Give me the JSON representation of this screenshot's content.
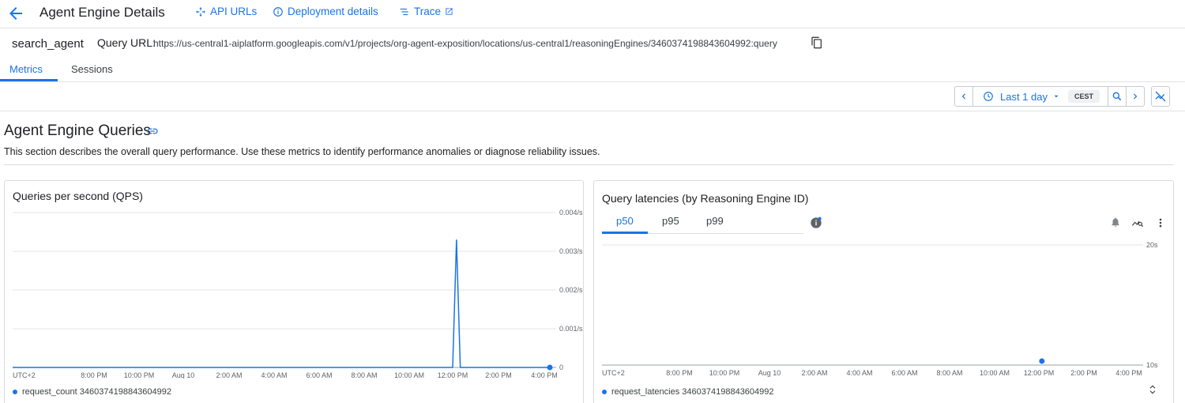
{
  "header": {
    "title": "Agent Engine Details",
    "links": {
      "api_urls": "API URLs",
      "deployment": "Deployment details",
      "trace": "Trace"
    }
  },
  "agent": {
    "name": "search_agent",
    "query_url_label": "Query URL:",
    "query_url": "https://us-central1-aiplatform.googleapis.com/v1/projects/org-agent-exposition/locations/us-central1/reasoningEngines/3460374198843604992:query"
  },
  "tabs": {
    "metrics": "Metrics",
    "sessions": "Sessions"
  },
  "toolbar": {
    "range": "Last 1 day",
    "timezone": "CEST"
  },
  "section": {
    "title": "Agent Engine Queries",
    "description": "This section describes the overall query performance. Use these metrics to identify performance anomalies or diagnose reliability issues."
  },
  "colors": {
    "accent": "#1a73e8",
    "grid": "#e6e6e6"
  },
  "chart_data": [
    {
      "type": "line",
      "title": "Queries per second (QPS)",
      "x_ticks": [
        "UTC+2",
        "8:00 PM",
        "10:00 PM",
        "Aug 10",
        "2:00 AM",
        "4:00 AM",
        "6:00 AM",
        "8:00 AM",
        "10:00 AM",
        "12:00 PM",
        "2:00 PM",
        "4:00 PM"
      ],
      "y_ticks": [
        "0.004/s",
        "0.003/s",
        "0.002/s",
        "0.001/s",
        "0"
      ],
      "ylim": [
        0,
        0.004
      ],
      "series": [
        {
          "name": "request_count 3460374198843604992",
          "points": [
            [
              "UTC+2",
              0
            ],
            [
              "12:00 PM",
              0
            ],
            [
              "12:10 PM",
              0.0033
            ],
            [
              "12:20 PM",
              0
            ],
            [
              "4:00 PM",
              0
            ],
            [
              "4:30 PM",
              0
            ]
          ]
        }
      ],
      "legend": "bottom"
    },
    {
      "type": "scatter",
      "title": "Query latencies (by Reasoning Engine ID)",
      "tabs": [
        "p50",
        "p95",
        "p99"
      ],
      "active_tab": "p50",
      "x_ticks": [
        "UTC+2",
        "8:00 PM",
        "10:00 PM",
        "Aug 10",
        "2:00 AM",
        "4:00 AM",
        "6:00 AM",
        "8:00 AM",
        "10:00 AM",
        "12:00 PM",
        "2:00 PM",
        "4:00 PM"
      ],
      "y_ticks": [
        "20s",
        "10s"
      ],
      "ylim": [
        10,
        20
      ],
      "series": [
        {
          "name": "request_latencies 3460374198843604992",
          "points": [
            [
              "12:10 PM",
              10.2
            ]
          ]
        }
      ],
      "legend": "bottom"
    }
  ]
}
